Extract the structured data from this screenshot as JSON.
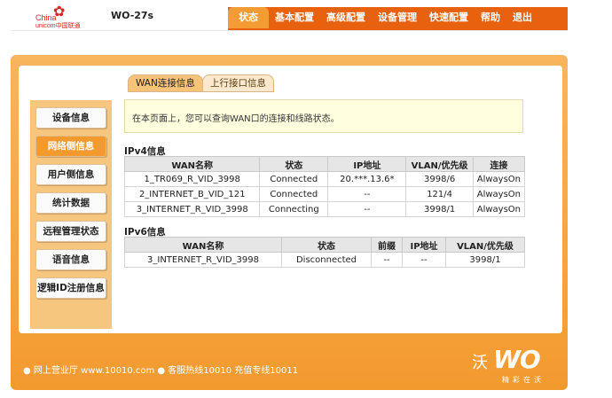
{
  "header": {
    "logo_text_en": "China",
    "logo_text_sub": "unicom中国联通",
    "model": "WO-27s",
    "nav": [
      "状态",
      "基本配置",
      "高级配置",
      "设备管理",
      "快速配置",
      "帮助",
      "退出"
    ],
    "active_nav": "状态"
  },
  "tabs": [
    {
      "label": "WAN连接信息",
      "active": true
    },
    {
      "label": "上行接口信息",
      "active": false
    }
  ],
  "sidebar": {
    "items": [
      "设备信息",
      "网络侧信息",
      "用户侧信息",
      "统计数据",
      "远程管理状态",
      "语音信息",
      "逻辑ID注册信息"
    ],
    "active": "网络侧信息"
  },
  "notice": "在本页面上，您可以查询WAN口的连接和线路状态。",
  "ipv4": {
    "title": "IPv4信息",
    "columns": [
      "WAN名称",
      "状态",
      "IP地址",
      "VLAN/优先级",
      "连接"
    ],
    "rows": [
      [
        "1_TR069_R_VID_3998",
        "Connected",
        "20.***.13.6*",
        "3998/6",
        "AlwaysOn"
      ],
      [
        "2_INTERNET_B_VID_121",
        "Connected",
        "--",
        "121/4",
        "AlwaysOn"
      ],
      [
        "3_INTERNET_R_VID_3998",
        "Connecting",
        "--",
        "3998/1",
        "AlwaysOn"
      ]
    ]
  },
  "ipv6": {
    "title": "IPv6信息",
    "columns": [
      "WAN名称",
      "状态",
      "前缀",
      "IP地址",
      "VLAN/优先级"
    ],
    "rows": [
      [
        "3_INTERNET_R_VID_3998",
        "Disconnected",
        "--",
        "--",
        "3998/1"
      ]
    ]
  },
  "footer": {
    "text": "● 网上营业厅  www.10010.com  ● 客服热线10010  充值专线10011",
    "brand": "WO",
    "slogan": "精彩在沃"
  }
}
